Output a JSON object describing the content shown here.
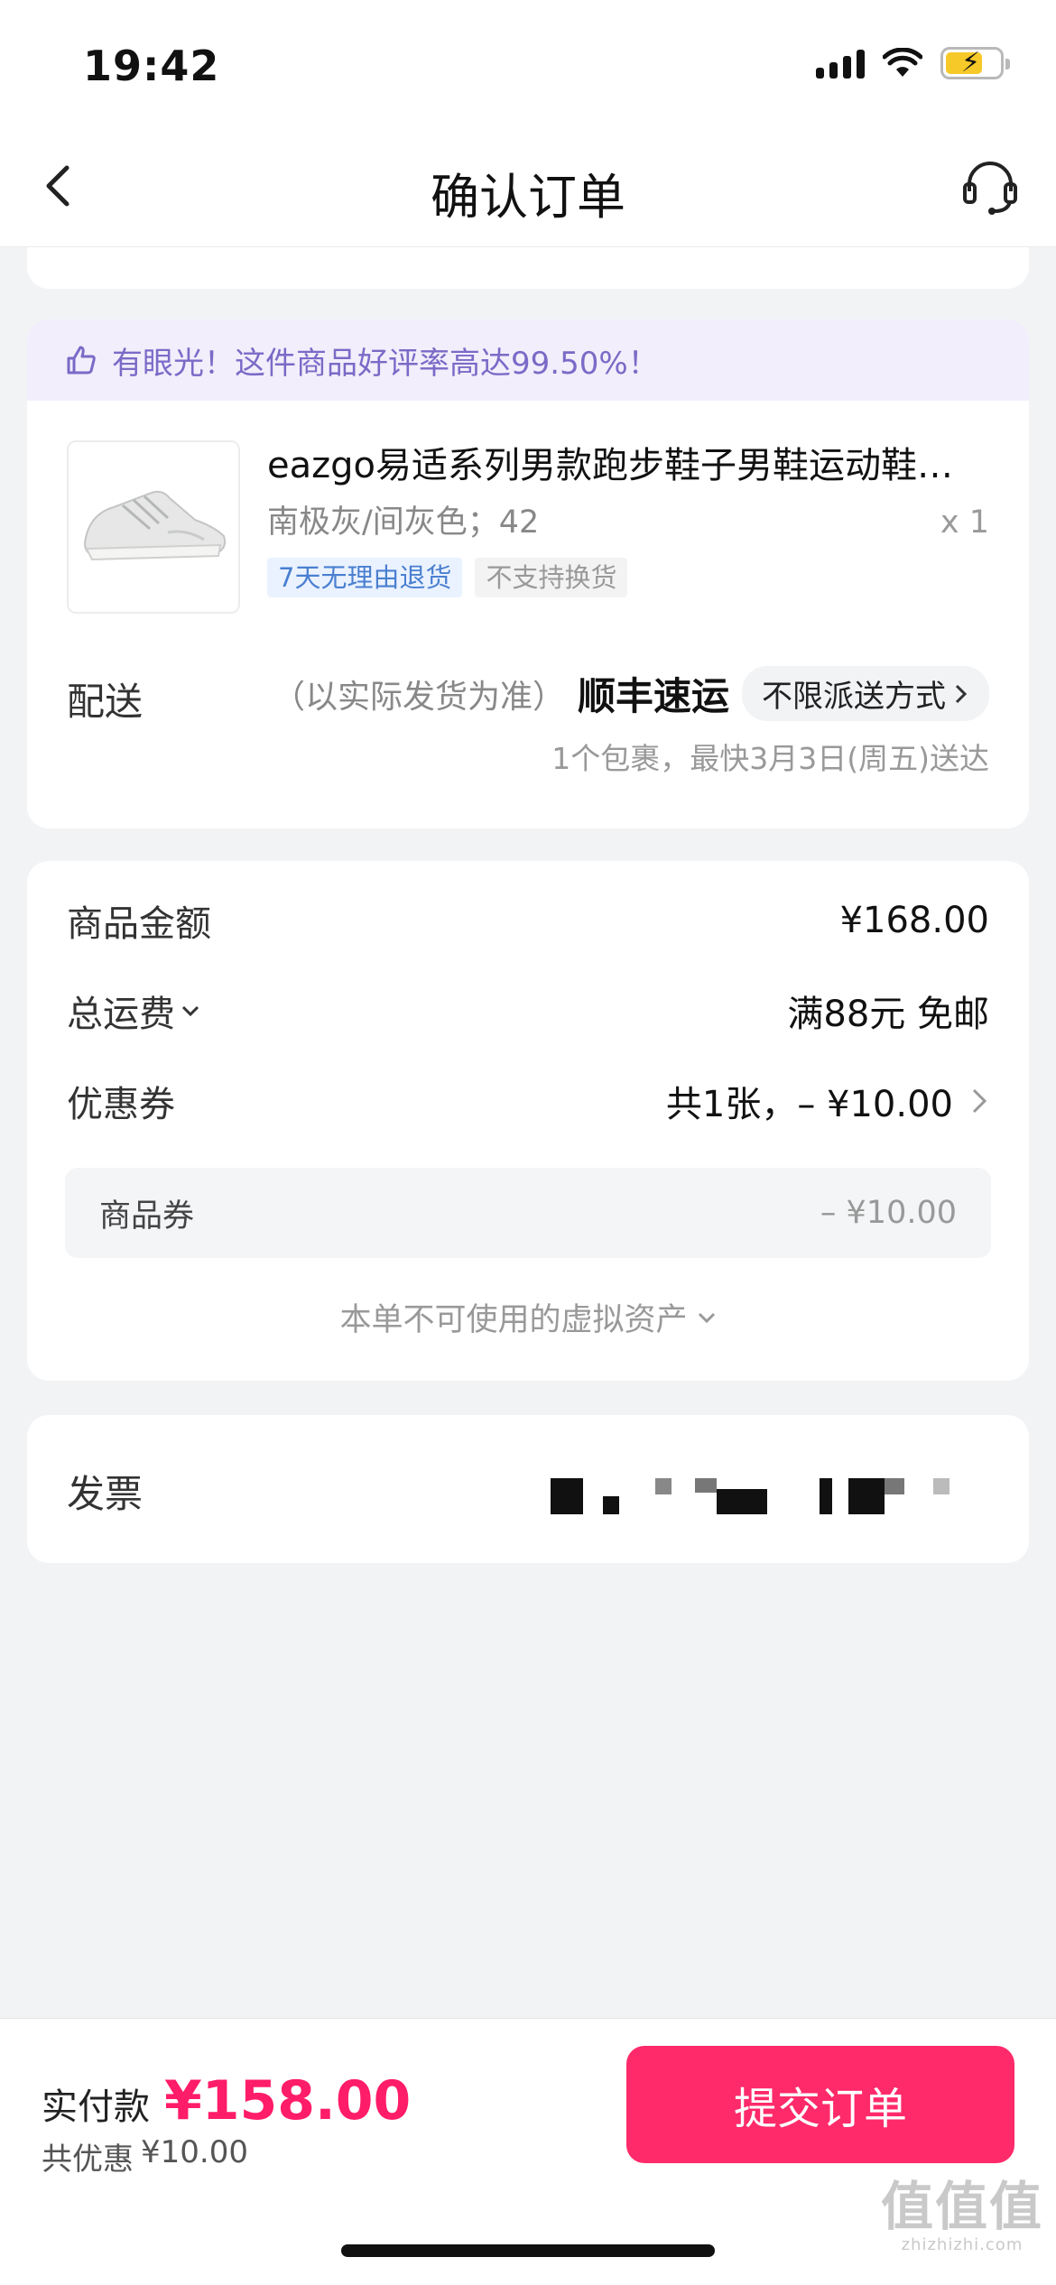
{
  "status_bar": {
    "time": "19:42"
  },
  "nav": {
    "title": "确认订单"
  },
  "promo": {
    "text": "有眼光！这件商品好评率高达99.50%！"
  },
  "product": {
    "name": "eazgo易适系列男款跑步鞋子男鞋运动鞋…",
    "spec": "南极灰/间灰色；42",
    "qty": "x 1",
    "tags": [
      "7天无理由退货",
      "不支持换货"
    ]
  },
  "delivery": {
    "label": "配送",
    "note": "（以实际发货为准）",
    "carrier": "顺丰速运",
    "option": "不限派送方式",
    "eta": "1个包裹，最快3月3日(周五)送达"
  },
  "costs": {
    "goods_label": "商品金额",
    "goods_value": "¥168.00",
    "shipping_label": "总运费",
    "shipping_value": "满88元 免邮",
    "coupon_label": "优惠券",
    "coupon_value": "共1张，– ¥10.00",
    "coupon_sub_label": "商品券",
    "coupon_sub_value": "– ¥10.00",
    "unusable_assets": "本单不可使用的虚拟资产"
  },
  "invoice": {
    "label": "发票"
  },
  "footer": {
    "pay_label": "实付款",
    "pay_amount": "¥158.00",
    "discount_label": "共优惠",
    "discount_value": "¥10.00",
    "submit_label": "提交订单"
  },
  "watermark": {
    "big": "值值值",
    "small": "zhizhizhi.com"
  },
  "colors": {
    "accent": "#ff2a6a",
    "price": "#ff1c69",
    "promo_bg": "#f2eefb",
    "promo_text": "#7b6ac7"
  }
}
